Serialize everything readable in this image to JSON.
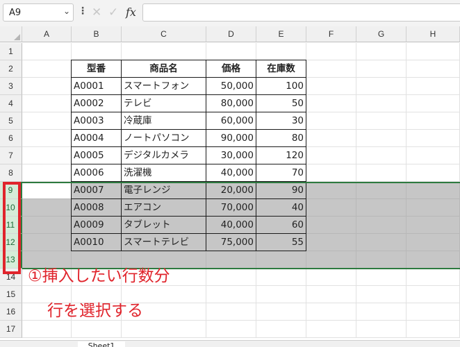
{
  "formula_bar": {
    "name_box": "A9",
    "name_box_icon": "chevron-down-icon",
    "cancel_icon": "✕",
    "enter_icon": "✓",
    "fx_label": "fx",
    "formula_value": ""
  },
  "columns": [
    "A",
    "B",
    "C",
    "D",
    "E",
    "F",
    "G",
    "H"
  ],
  "rows": [
    "1",
    "2",
    "3",
    "4",
    "5",
    "6",
    "7",
    "8",
    "9",
    "10",
    "11",
    "12",
    "13",
    "14",
    "15",
    "16",
    "17"
  ],
  "table": {
    "headers": [
      "型番",
      "商品名",
      "価格",
      "在庫数"
    ],
    "rows": [
      [
        "A0001",
        "スマートフォン",
        "50,000",
        "100"
      ],
      [
        "A0002",
        "テレビ",
        "80,000",
        "50"
      ],
      [
        "A0003",
        "冷蔵庫",
        "60,000",
        "30"
      ],
      [
        "A0004",
        "ノートパソコン",
        "90,000",
        "80"
      ],
      [
        "A0005",
        "デジタルカメラ",
        "30,000",
        "120"
      ],
      [
        "A0006",
        "洗濯機",
        "40,000",
        "70"
      ],
      [
        "A0007",
        "電子レンジ",
        "20,000",
        "90"
      ],
      [
        "A0008",
        "エアコン",
        "70,000",
        "40"
      ],
      [
        "A0009",
        "タブレット",
        "40,000",
        "60"
      ],
      [
        "A0010",
        "スマートテレビ",
        "75,000",
        "55"
      ]
    ]
  },
  "selection": {
    "rows": [
      "9",
      "10",
      "11",
      "12",
      "13"
    ],
    "active_cell": "A9"
  },
  "annotation": {
    "line1": "①挿入したい行数分",
    "line2": "行を選択する",
    "color": "#e0242c"
  },
  "colors": {
    "selection_accent": "#2d7a3f",
    "selection_fill": "#c6c6c6"
  },
  "sheet_tab": {
    "label": "Sheet1"
  }
}
